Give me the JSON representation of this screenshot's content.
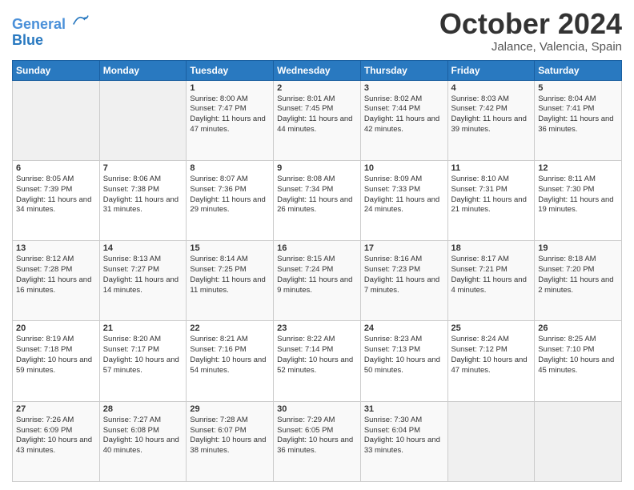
{
  "logo": {
    "line1": "General",
    "line2": "Blue"
  },
  "title": "October 2024",
  "subtitle": "Jalance, Valencia, Spain",
  "weekdays": [
    "Sunday",
    "Monday",
    "Tuesday",
    "Wednesday",
    "Thursday",
    "Friday",
    "Saturday"
  ],
  "weeks": [
    [
      {
        "day": "",
        "info": ""
      },
      {
        "day": "",
        "info": ""
      },
      {
        "day": "1",
        "info": "Sunrise: 8:00 AM\nSunset: 7:47 PM\nDaylight: 11 hours and 47 minutes."
      },
      {
        "day": "2",
        "info": "Sunrise: 8:01 AM\nSunset: 7:45 PM\nDaylight: 11 hours and 44 minutes."
      },
      {
        "day": "3",
        "info": "Sunrise: 8:02 AM\nSunset: 7:44 PM\nDaylight: 11 hours and 42 minutes."
      },
      {
        "day": "4",
        "info": "Sunrise: 8:03 AM\nSunset: 7:42 PM\nDaylight: 11 hours and 39 minutes."
      },
      {
        "day": "5",
        "info": "Sunrise: 8:04 AM\nSunset: 7:41 PM\nDaylight: 11 hours and 36 minutes."
      }
    ],
    [
      {
        "day": "6",
        "info": "Sunrise: 8:05 AM\nSunset: 7:39 PM\nDaylight: 11 hours and 34 minutes."
      },
      {
        "day": "7",
        "info": "Sunrise: 8:06 AM\nSunset: 7:38 PM\nDaylight: 11 hours and 31 minutes."
      },
      {
        "day": "8",
        "info": "Sunrise: 8:07 AM\nSunset: 7:36 PM\nDaylight: 11 hours and 29 minutes."
      },
      {
        "day": "9",
        "info": "Sunrise: 8:08 AM\nSunset: 7:34 PM\nDaylight: 11 hours and 26 minutes."
      },
      {
        "day": "10",
        "info": "Sunrise: 8:09 AM\nSunset: 7:33 PM\nDaylight: 11 hours and 24 minutes."
      },
      {
        "day": "11",
        "info": "Sunrise: 8:10 AM\nSunset: 7:31 PM\nDaylight: 11 hours and 21 minutes."
      },
      {
        "day": "12",
        "info": "Sunrise: 8:11 AM\nSunset: 7:30 PM\nDaylight: 11 hours and 19 minutes."
      }
    ],
    [
      {
        "day": "13",
        "info": "Sunrise: 8:12 AM\nSunset: 7:28 PM\nDaylight: 11 hours and 16 minutes."
      },
      {
        "day": "14",
        "info": "Sunrise: 8:13 AM\nSunset: 7:27 PM\nDaylight: 11 hours and 14 minutes."
      },
      {
        "day": "15",
        "info": "Sunrise: 8:14 AM\nSunset: 7:25 PM\nDaylight: 11 hours and 11 minutes."
      },
      {
        "day": "16",
        "info": "Sunrise: 8:15 AM\nSunset: 7:24 PM\nDaylight: 11 hours and 9 minutes."
      },
      {
        "day": "17",
        "info": "Sunrise: 8:16 AM\nSunset: 7:23 PM\nDaylight: 11 hours and 7 minutes."
      },
      {
        "day": "18",
        "info": "Sunrise: 8:17 AM\nSunset: 7:21 PM\nDaylight: 11 hours and 4 minutes."
      },
      {
        "day": "19",
        "info": "Sunrise: 8:18 AM\nSunset: 7:20 PM\nDaylight: 11 hours and 2 minutes."
      }
    ],
    [
      {
        "day": "20",
        "info": "Sunrise: 8:19 AM\nSunset: 7:18 PM\nDaylight: 10 hours and 59 minutes."
      },
      {
        "day": "21",
        "info": "Sunrise: 8:20 AM\nSunset: 7:17 PM\nDaylight: 10 hours and 57 minutes."
      },
      {
        "day": "22",
        "info": "Sunrise: 8:21 AM\nSunset: 7:16 PM\nDaylight: 10 hours and 54 minutes."
      },
      {
        "day": "23",
        "info": "Sunrise: 8:22 AM\nSunset: 7:14 PM\nDaylight: 10 hours and 52 minutes."
      },
      {
        "day": "24",
        "info": "Sunrise: 8:23 AM\nSunset: 7:13 PM\nDaylight: 10 hours and 50 minutes."
      },
      {
        "day": "25",
        "info": "Sunrise: 8:24 AM\nSunset: 7:12 PM\nDaylight: 10 hours and 47 minutes."
      },
      {
        "day": "26",
        "info": "Sunrise: 8:25 AM\nSunset: 7:10 PM\nDaylight: 10 hours and 45 minutes."
      }
    ],
    [
      {
        "day": "27",
        "info": "Sunrise: 7:26 AM\nSunset: 6:09 PM\nDaylight: 10 hours and 43 minutes."
      },
      {
        "day": "28",
        "info": "Sunrise: 7:27 AM\nSunset: 6:08 PM\nDaylight: 10 hours and 40 minutes."
      },
      {
        "day": "29",
        "info": "Sunrise: 7:28 AM\nSunset: 6:07 PM\nDaylight: 10 hours and 38 minutes."
      },
      {
        "day": "30",
        "info": "Sunrise: 7:29 AM\nSunset: 6:05 PM\nDaylight: 10 hours and 36 minutes."
      },
      {
        "day": "31",
        "info": "Sunrise: 7:30 AM\nSunset: 6:04 PM\nDaylight: 10 hours and 33 minutes."
      },
      {
        "day": "",
        "info": ""
      },
      {
        "day": "",
        "info": ""
      }
    ]
  ]
}
